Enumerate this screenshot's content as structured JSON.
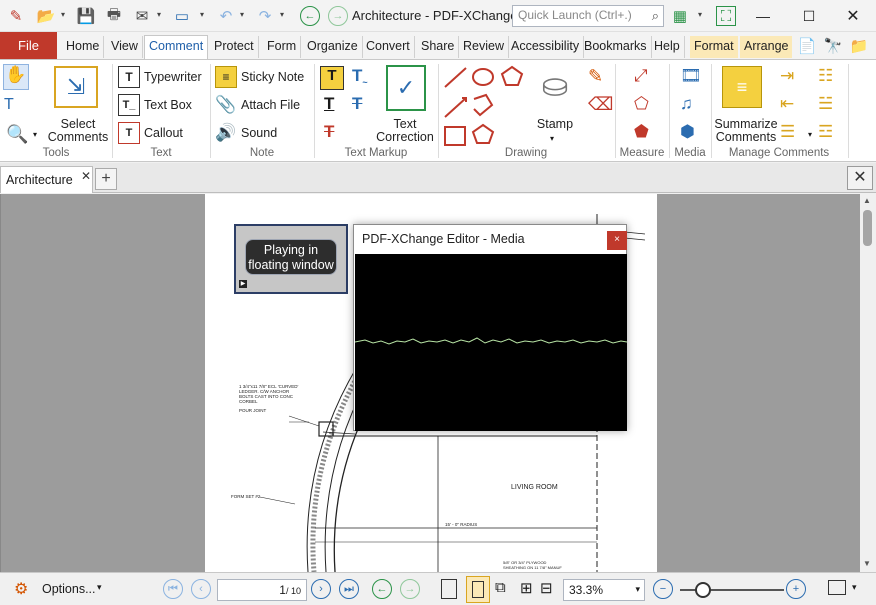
{
  "titlebar": {
    "title": "Architecture - PDF-XChange...",
    "quick_launch_placeholder": "Quick Launch (Ctrl+.)"
  },
  "tabs": {
    "file": "File",
    "home": "Home",
    "view": "View",
    "comment": "Comment",
    "protect": "Protect",
    "form": "Form",
    "organize": "Organize",
    "convert": "Convert",
    "share": "Share",
    "review": "Review",
    "accessibility": "Accessibility",
    "bookmarks": "Bookmarks",
    "help": "Help",
    "format": "Format",
    "arrange": "Arrange"
  },
  "ribbon": {
    "groups": {
      "tools": "Tools",
      "text": "Text",
      "note": "Note",
      "text_markup": "Text Markup",
      "drawing": "Drawing",
      "measure": "Measure",
      "media": "Media",
      "manage_comments": "Manage Comments"
    },
    "select_comments": "Select\nComments",
    "typewriter": "Typewriter",
    "text_box": "Text Box",
    "callout": "Callout",
    "sticky_note": "Sticky Note",
    "attach_file": "Attach File",
    "sound": "Sound",
    "text_correction": "Text\nCorrection",
    "stamp": "Stamp",
    "summarize_comments": "Summarize\nComments"
  },
  "document": {
    "tab_label": "Architecture",
    "media_button_label": "Playing in\nfloating window",
    "drawing_labels": {
      "curved_ledger": "1 3/4\"x11 7/8\" ECL 'CURVED'\nLEDGER. C/W ANCHOR\nBOLTS CAST INTO CONC\nCORBEL",
      "pour_joint": "POUR JOINT",
      "form_set": "FORM SET #2",
      "living_room": "LIVING ROOM",
      "radius": "15' - 0\" RADIUS",
      "plywood": "5/8\" OR 3/4\" PLYWOOD\nSHEATHING ON 11 7/8\" MANUF"
    }
  },
  "media_window": {
    "title": "PDF-XChange Editor - Media",
    "close": "×"
  },
  "statusbar": {
    "options": "Options...",
    "page_current": "1",
    "page_total": "/ 10",
    "zoom": "33.3%"
  },
  "colors": {
    "file_tab": "#c0392b",
    "accent": "#1f5fa9",
    "contextual_tab": "#fbe9b7"
  }
}
